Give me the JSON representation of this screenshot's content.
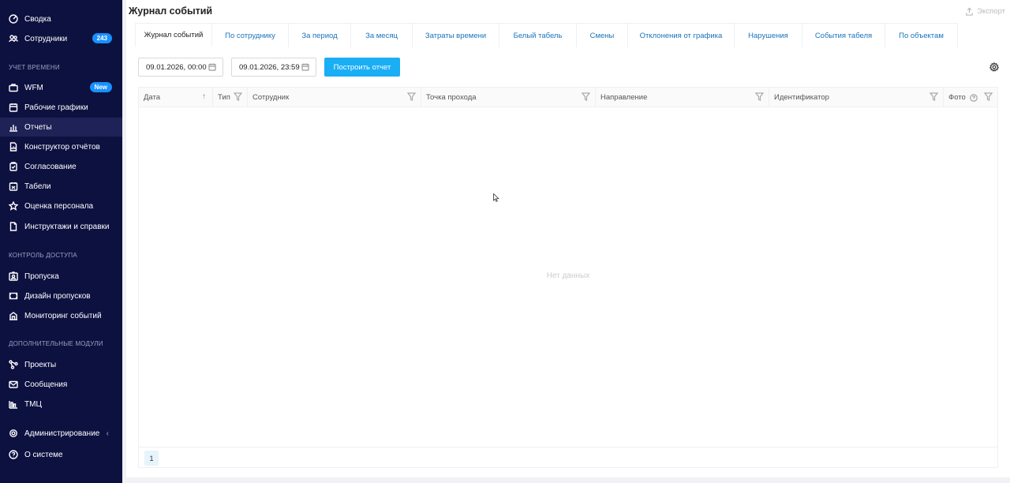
{
  "sidebar": {
    "items_top": [
      {
        "label": "Сводка",
        "icon": "dashboard-icon"
      },
      {
        "label": "Сотрудники",
        "icon": "users-icon",
        "badge": "243"
      }
    ],
    "section_time": "УЧЕТ ВРЕМЕНИ",
    "items_time": [
      {
        "label": "WFM",
        "icon": "briefcase-icon",
        "badge": "New"
      },
      {
        "label": "Рабочие графики",
        "icon": "calendar-icon"
      },
      {
        "label": "Отчеты",
        "icon": "bar-chart-icon"
      },
      {
        "label": "Конструктор отчётов",
        "icon": "report-builder-icon"
      },
      {
        "label": "Согласование",
        "icon": "approval-icon"
      },
      {
        "label": "Табели",
        "icon": "timesheet-icon"
      },
      {
        "label": "Оценка персонала",
        "icon": "star-icon"
      },
      {
        "label": "Инструктажи и справки",
        "icon": "document-icon"
      }
    ],
    "section_access": "КОНТРОЛЬ ДОСТУПА",
    "items_access": [
      {
        "label": "Пропуска",
        "icon": "badge-icon"
      },
      {
        "label": "Дизайн пропусков",
        "icon": "pass-design-icon"
      },
      {
        "label": "Мониторинг событий",
        "icon": "monitoring-icon"
      }
    ],
    "section_extra": "ДОПОЛНИТЕЛЬНЫЕ МОДУЛИ",
    "items_extra": [
      {
        "label": "Проекты",
        "icon": "projects-icon"
      },
      {
        "label": "Сообщения",
        "icon": "mail-icon"
      },
      {
        "label": "ТМЦ",
        "icon": "inventory-icon"
      }
    ],
    "items_bottom": [
      {
        "label": "Администрирование",
        "icon": "gear-icon"
      },
      {
        "label": "О системе",
        "icon": "question-icon"
      }
    ],
    "active": "Отчеты"
  },
  "header": {
    "title": "Журнал событий",
    "export_label": "Экспорт"
  },
  "tabs": [
    "Журнал событий",
    "По сотруднику",
    "За период",
    "За месяц",
    "Затраты времени",
    "Белый табель",
    "Смены",
    "Отклонения от графика",
    "Нарушения",
    "События табеля",
    "По объектам"
  ],
  "active_tab": "Журнал событий",
  "filters": {
    "date_from": "09.01.2026, 00:00",
    "date_to": "09.01.2026, 23:59",
    "build_label": "Построить отчет"
  },
  "table": {
    "columns": [
      "Дата",
      "Тип",
      "Сотрудник",
      "Точка прохода",
      "Направление",
      "Идентификатор",
      "Фото"
    ],
    "empty_text": "Нет данных",
    "page": "1"
  },
  "colors": {
    "sidebar_bg": "#0d1140",
    "accent": "#1aaef5",
    "badge": "#1890ff",
    "tab_link": "#1a73b8"
  }
}
